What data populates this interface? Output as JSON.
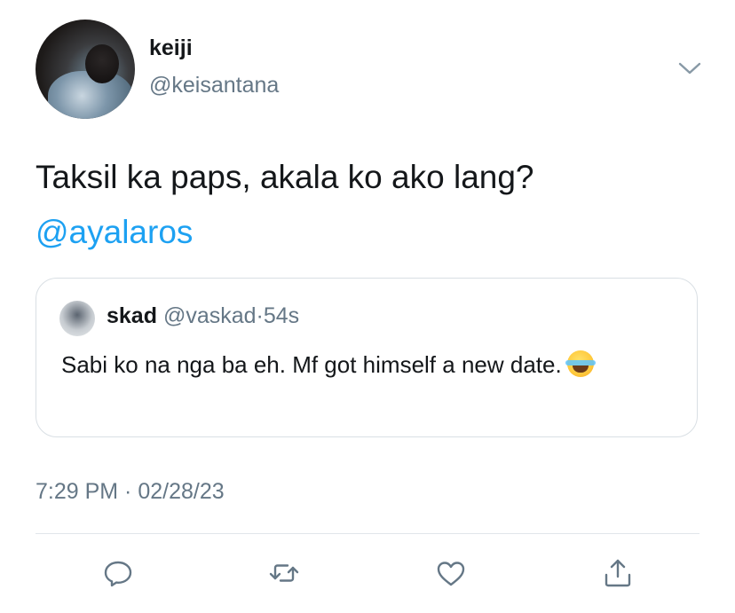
{
  "author": {
    "name": "keiji",
    "handle": "@keisantana"
  },
  "tweet": {
    "text": "Taksil ka paps, akala ko ako lang?",
    "mention": "@ayalaros"
  },
  "quote": {
    "name": "skad",
    "handle": "@vaskad",
    "separator": "·",
    "time": "54s",
    "text": "Sabi ko na nga ba eh. Mf got himself a new date."
  },
  "timestamp": "7:29 PM · 02/28/23",
  "actions": [
    "reply-icon",
    "retweet-icon",
    "like-icon",
    "share-icon"
  ]
}
